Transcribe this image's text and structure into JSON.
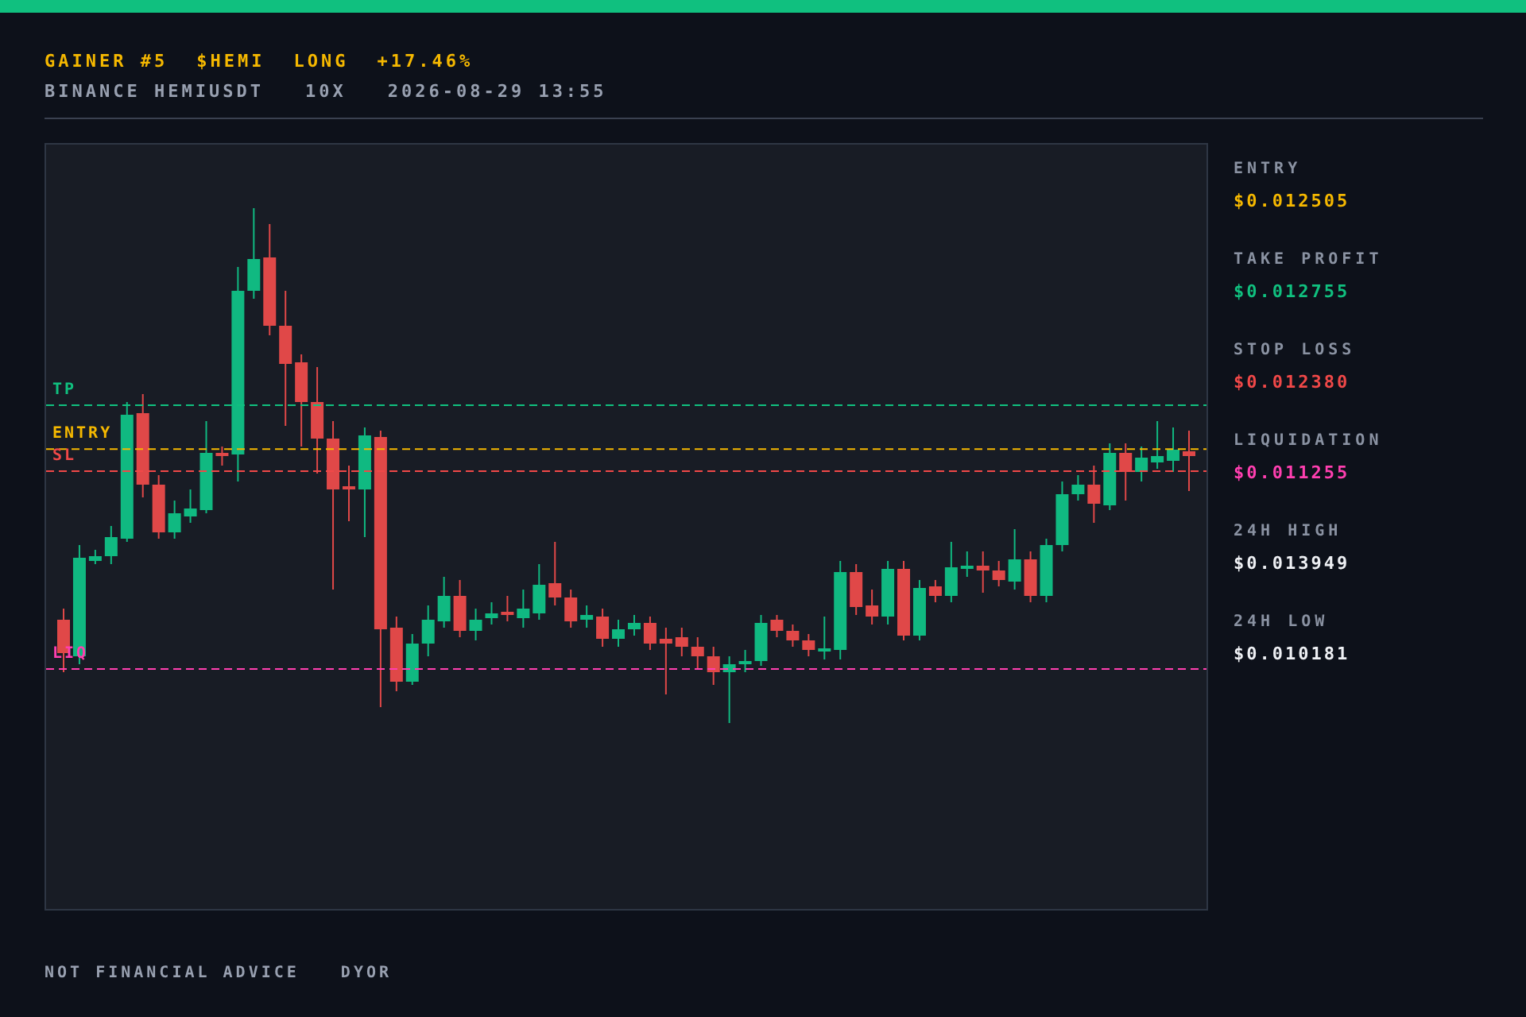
{
  "header": {
    "headline": [
      "GAINER #5",
      "$HEMI",
      "LONG",
      "+17.46%"
    ],
    "subline": [
      "BINANCE HEMIUSDT",
      "10X",
      "2026-08-29 13:55"
    ]
  },
  "chart": {
    "levels": [
      {
        "label": "TP",
        "color": "#10c07f"
      },
      {
        "label": "ENTRY",
        "color": "#f5b800"
      },
      {
        "label": "SL",
        "color": "#f04848"
      },
      {
        "label": "LIQ",
        "color": "#ff3fb0"
      }
    ]
  },
  "stats": [
    {
      "label": "ENTRY",
      "value": "$0.012505",
      "color": "#f5b800"
    },
    {
      "label": "TAKE PROFIT",
      "value": "$0.012755",
      "color": "#10c07f"
    },
    {
      "label": "STOP LOSS",
      "value": "$0.012380",
      "color": "#f04848"
    },
    {
      "label": "LIQUIDATION",
      "value": "$0.011255",
      "color": "#ff3fb0"
    },
    {
      "label": "24H HIGH",
      "value": "$0.013949",
      "color": "#eef0f4"
    },
    {
      "label": "24H LOW",
      "value": "$0.010181",
      "color": "#eef0f4"
    }
  ],
  "footer": [
    "NOT FINANCIAL ADVICE",
    "DYOR"
  ]
}
